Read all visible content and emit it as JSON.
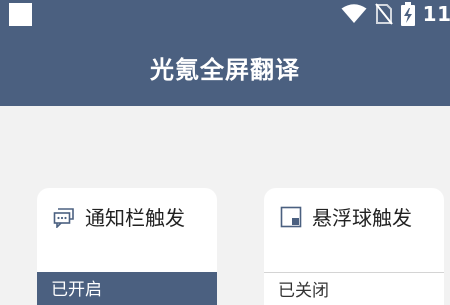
{
  "status_bar": {
    "time": "11:",
    "icons": [
      "wifi-icon",
      "no-sim-icon",
      "battery-charging-icon"
    ]
  },
  "app": {
    "title": "光氪全屏翻译"
  },
  "cards": [
    {
      "label": "通知栏触发",
      "icon": "notification-chat-icon",
      "status": "已开启",
      "active": true
    },
    {
      "label": "悬浮球触发",
      "icon": "floating-window-icon",
      "status": "已关闭",
      "active": false
    }
  ],
  "colors": {
    "primary": "#4b6080",
    "background": "#f2f2f2",
    "card": "#ffffff"
  }
}
